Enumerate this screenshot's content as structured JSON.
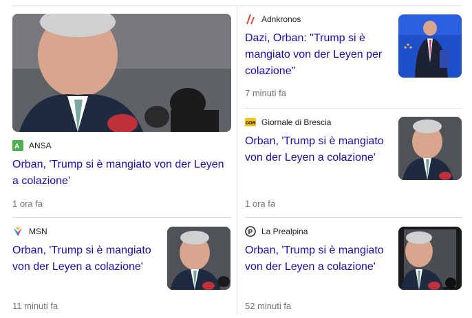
{
  "colors": {
    "link": "#1a0dab",
    "meta": "#70757a",
    "divider": "#dadce0"
  },
  "cards": [
    {
      "source": "ANSA",
      "source_logo": "ansa-logo-icon",
      "headline": "Orban, 'Trump si è mangiato von der Leyen a colazione'",
      "time": "1 ora fa",
      "image": "orban-closeup-photo"
    },
    {
      "source": "Adnkronos",
      "source_logo": "adnkronos-logo-icon",
      "headline": "Dazi, Orban: \"Trump si è mangiato von der Leyen per colazione\"",
      "time": "7 minuti fa",
      "image": "orban-walking-photo"
    },
    {
      "source": "Giornale di Brescia",
      "source_logo": "gdb-logo-icon",
      "logo_text": "GDB",
      "headline": "Orban, 'Trump si è mangiato von der Leyen a colazione'",
      "time": "1 ora fa",
      "image": "orban-closeup-photo"
    },
    {
      "source": "MSN",
      "source_logo": "msn-logo-icon",
      "headline": "Orban, 'Trump si è mangiato von der Leyen a colazione'",
      "time": "11 minuti fa",
      "image": "orban-closeup-photo"
    },
    {
      "source": "La Prealpina",
      "source_logo": "laprealpina-logo-icon",
      "headline": "Orban, 'Trump si è mangiato von der Leyen a colazione'",
      "time": "52 minuti fa",
      "image": "orban-closeup-photo"
    }
  ]
}
